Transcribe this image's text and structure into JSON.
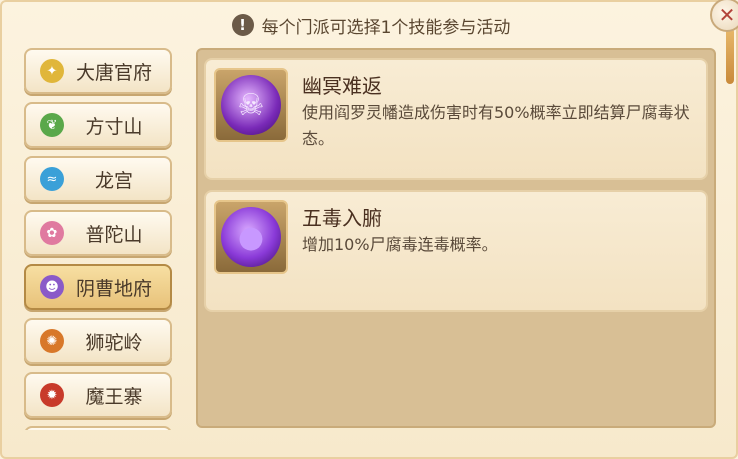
{
  "header": {
    "notice": "每个门派可选择1个技能参与活动",
    "warn_symbol": "!",
    "close_symbol": "✕"
  },
  "sects": [
    {
      "label": "大唐官府",
      "icon": "dagger-icon",
      "color": "#e0b63a",
      "active": false
    },
    {
      "label": "方寸山",
      "icon": "leaf-icon",
      "color": "#5aa84a",
      "active": false
    },
    {
      "label": "龙宫",
      "icon": "wave-icon",
      "color": "#3aa0d8",
      "active": false
    },
    {
      "label": "普陀山",
      "icon": "lotus-icon",
      "color": "#e07aa0",
      "active": false
    },
    {
      "label": "阴曹地府",
      "icon": "skull-icon",
      "color": "#8a5ac8",
      "active": true
    },
    {
      "label": "狮驼岭",
      "icon": "lion-icon",
      "color": "#d8782a",
      "active": false
    },
    {
      "label": "魔王寨",
      "icon": "demon-icon",
      "color": "#c83a2a",
      "active": false
    }
  ],
  "skills": [
    {
      "name": "幽冥难返",
      "desc": "使用阎罗灵幡造成伤害时有50%概率立即结算尸腐毒状态。",
      "icon": "skull-spirit-icon",
      "glyph": "☠"
    },
    {
      "name": "五毒入腑",
      "desc": "增加10%尸腐毒连毒概率。",
      "icon": "poison-cloud-icon",
      "glyph": "●"
    }
  ]
}
